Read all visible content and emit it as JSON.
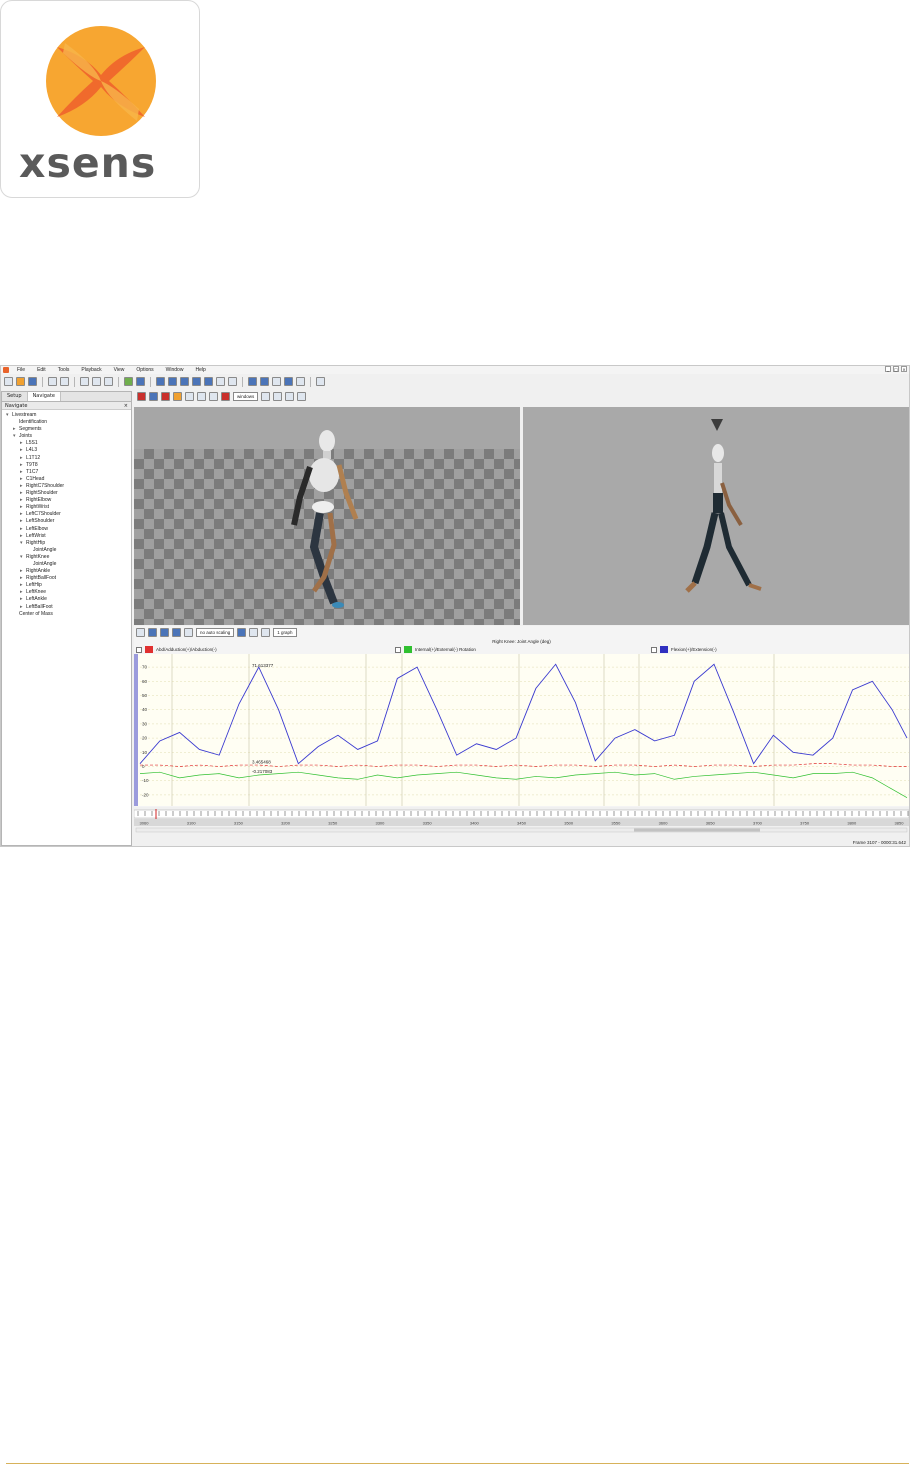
{
  "logo": {
    "word": "xsens"
  },
  "menubar": {
    "items": [
      "File",
      "Edit",
      "Tools",
      "Playback",
      "View",
      "Options",
      "Window",
      "Help"
    ]
  },
  "toolbar": {
    "view_select": "windows"
  },
  "left_panel": {
    "tabs": [
      "Setup",
      "Navigate"
    ],
    "active_tab": "Navigate",
    "title": "Navigate",
    "tree": [
      {
        "label": "Livestream",
        "depth": 0,
        "expander": "▾"
      },
      {
        "label": "Identification",
        "depth": 1,
        "expander": ""
      },
      {
        "label": "Segments",
        "depth": 1,
        "expander": "▸"
      },
      {
        "label": "Joints",
        "depth": 1,
        "expander": "▾"
      },
      {
        "label": "L5S1",
        "depth": 2,
        "expander": "▸"
      },
      {
        "label": "L4L3",
        "depth": 2,
        "expander": "▸"
      },
      {
        "label": "L1T12",
        "depth": 2,
        "expander": "▸"
      },
      {
        "label": "T9T8",
        "depth": 2,
        "expander": "▸"
      },
      {
        "label": "T1C7",
        "depth": 2,
        "expander": "▸"
      },
      {
        "label": "C1Head",
        "depth": 2,
        "expander": "▸"
      },
      {
        "label": "RightC7Shoulder",
        "depth": 2,
        "expander": "▸"
      },
      {
        "label": "RightShoulder",
        "depth": 2,
        "expander": "▸"
      },
      {
        "label": "RightElbow",
        "depth": 2,
        "expander": "▸"
      },
      {
        "label": "RightWrist",
        "depth": 2,
        "expander": "▸"
      },
      {
        "label": "LeftC7Shoulder",
        "depth": 2,
        "expander": "▸"
      },
      {
        "label": "LeftShoulder",
        "depth": 2,
        "expander": "▸"
      },
      {
        "label": "LeftElbow",
        "depth": 2,
        "expander": "▸"
      },
      {
        "label": "LeftWrist",
        "depth": 2,
        "expander": "▸"
      },
      {
        "label": "RightHip",
        "depth": 2,
        "expander": "▾"
      },
      {
        "label": "JointAngle",
        "depth": 3,
        "expander": ""
      },
      {
        "label": "RightKnee",
        "depth": 2,
        "expander": "▾"
      },
      {
        "label": "JointAngle",
        "depth": 3,
        "expander": ""
      },
      {
        "label": "RightAnkle",
        "depth": 2,
        "expander": "▸"
      },
      {
        "label": "RightBallFoot",
        "depth": 2,
        "expander": "▸"
      },
      {
        "label": "LeftHip",
        "depth": 2,
        "expander": "▸"
      },
      {
        "label": "LeftKnee",
        "depth": 2,
        "expander": "▸"
      },
      {
        "label": "LeftAnkle",
        "depth": 2,
        "expander": "▸"
      },
      {
        "label": "LeftBallFoot",
        "depth": 2,
        "expander": "▸"
      },
      {
        "label": "Center of Mass",
        "depth": 1,
        "expander": ""
      }
    ]
  },
  "graph": {
    "toolbar_select_1": "no auto scaling",
    "toolbar_select_2": "1 graph",
    "title": "Right Knee: Joint Angle (deg)",
    "legend": [
      {
        "label": "Abd/Adduction(+)/Abduction(-)",
        "color": "#e03030"
      },
      {
        "label": "Internal(+)/External(-) Rotation",
        "color": "#30c030"
      },
      {
        "label": "Flexion(+)/Extension(-)",
        "color": "#3030c0"
      }
    ],
    "cursor_labels": [
      "71.613377",
      "3.465468",
      "-0.217083"
    ],
    "y_ticks": [
      "70",
      "60",
      "50",
      "40",
      "30",
      "20",
      "10",
      "0",
      "-10",
      "-20"
    ]
  },
  "chart_data": {
    "type": "line",
    "title": "Right Knee: Joint Angle (deg)",
    "x": [
      0,
      20,
      40,
      60,
      80,
      100,
      120,
      140,
      160,
      180,
      200,
      220,
      240,
      260,
      280,
      300,
      320,
      340,
      360,
      380,
      400,
      420,
      440,
      460,
      480,
      500,
      520,
      540,
      560,
      580,
      600,
      620,
      640,
      660,
      680,
      700,
      720,
      740,
      760,
      775
    ],
    "ylim": [
      -25,
      75
    ],
    "series": [
      {
        "name": "Flexion(+)/Extension(-)",
        "color": "#3a3ad0",
        "values": [
          2,
          18,
          24,
          12,
          8,
          44,
          70,
          40,
          2,
          14,
          22,
          12,
          18,
          62,
          70,
          40,
          8,
          16,
          12,
          20,
          55,
          72,
          45,
          4,
          20,
          26,
          18,
          22,
          60,
          72,
          38,
          2,
          22,
          10,
          8,
          20,
          54,
          60,
          40,
          20
        ]
      },
      {
        "name": "Abd/Adduction(+)/Abduction(-)",
        "color": "#e03030",
        "values": [
          1,
          1,
          0,
          1,
          0,
          1,
          1,
          0,
          1,
          1,
          0,
          1,
          0,
          1,
          1,
          0,
          1,
          1,
          0,
          1,
          0,
          1,
          1,
          0,
          1,
          1,
          0,
          1,
          0,
          1,
          1,
          0,
          1,
          1,
          2,
          2,
          1,
          1,
          0,
          0
        ]
      },
      {
        "name": "Internal(+)/External(-) Rotation",
        "color": "#30c030",
        "values": [
          -5,
          -4,
          -8,
          -6,
          -5,
          -8,
          -6,
          -5,
          -4,
          -6,
          -8,
          -9,
          -6,
          -8,
          -6,
          -5,
          -4,
          -6,
          -8,
          -9,
          -7,
          -8,
          -6,
          -5,
          -4,
          -6,
          -5,
          -9,
          -7,
          -6,
          -5,
          -4,
          -6,
          -8,
          -5,
          -5,
          -4,
          -8,
          -16,
          -22
        ]
      }
    ]
  },
  "timeline": {
    "ticks": [
      "3060",
      "3100",
      "3150",
      "3200",
      "3250",
      "3300",
      "3350",
      "3400",
      "3450",
      "3500",
      "3550",
      "3600",
      "3650",
      "3700",
      "3750",
      "3800",
      "3850"
    ]
  },
  "status": {
    "frame_text": "Frame 3107 - 0000:31.642"
  }
}
